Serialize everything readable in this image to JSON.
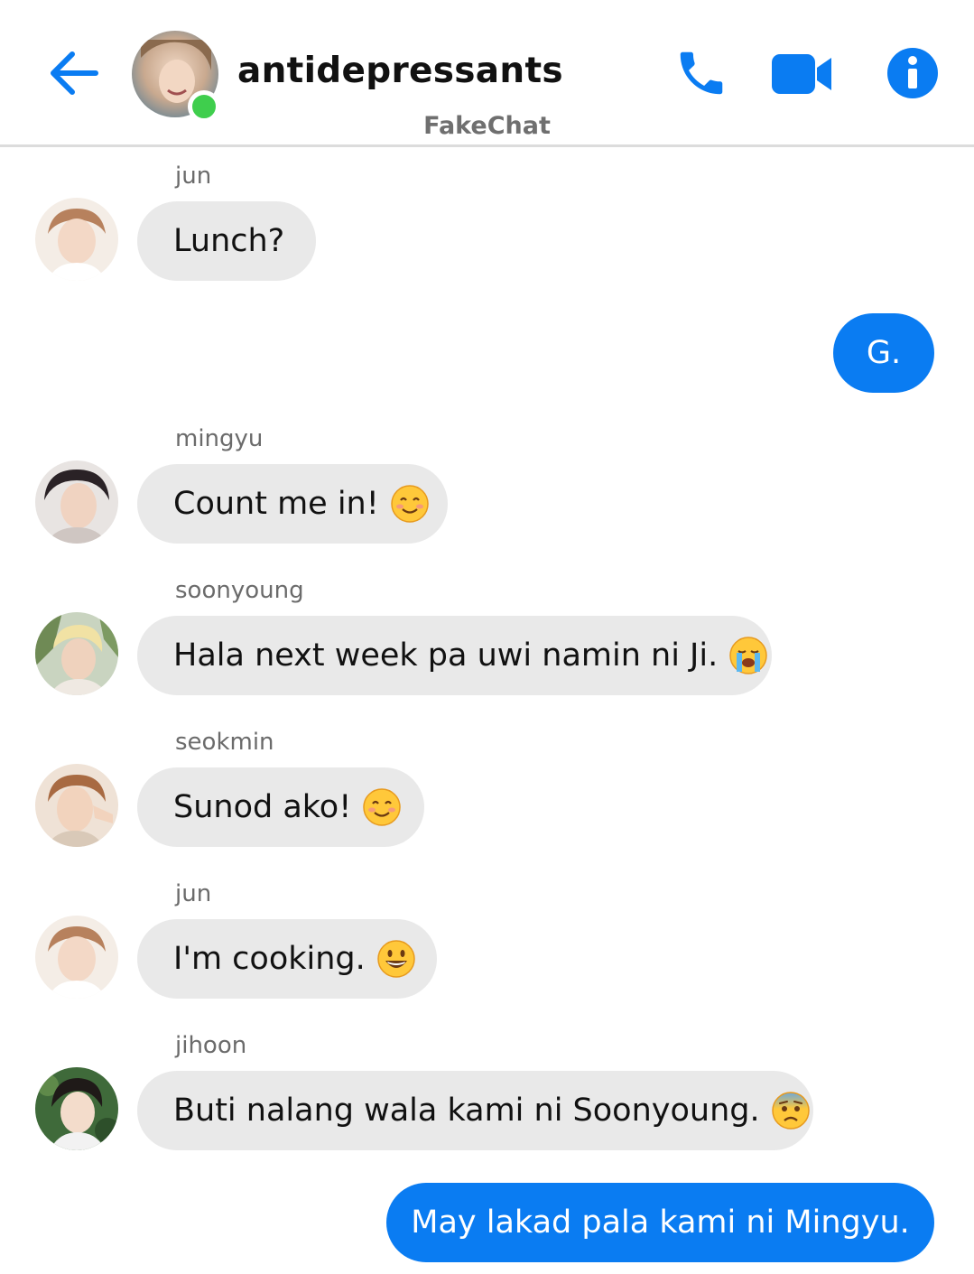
{
  "header": {
    "title": "antidepressants",
    "watermark": "FakeChat",
    "online": true,
    "accent_color": "#0a7cf2"
  },
  "icons": {
    "back": "back-arrow-icon",
    "call": "phone-icon",
    "video": "video-camera-icon",
    "info": "info-icon"
  },
  "colors": {
    "incoming_bubble": "#e9e9e9",
    "outgoing_bubble": "#0a7cf2",
    "online_dot": "#3fce4d"
  },
  "messages": [
    {
      "direction": "in",
      "sender": "jun",
      "text": "Lunch?",
      "emoji": ""
    },
    {
      "direction": "out",
      "sender": "",
      "text": "G.",
      "emoji": ""
    },
    {
      "direction": "in",
      "sender": "mingyu",
      "text": "Count me in!",
      "emoji": "smiling-face"
    },
    {
      "direction": "in",
      "sender": "soonyoung",
      "text": "Hala next week pa uwi namin ni Ji.",
      "emoji": "loudly-crying-face"
    },
    {
      "direction": "in",
      "sender": "seokmin",
      "text": "Sunod ako!",
      "emoji": "smiling-face"
    },
    {
      "direction": "in",
      "sender": "jun",
      "text": "I'm cooking.",
      "emoji": "grinning-face"
    },
    {
      "direction": "in",
      "sender": "jihoon",
      "text": "Buti nalang wala kami ni Soonyoung.",
      "emoji": "anxious-face"
    },
    {
      "direction": "out",
      "sender": "",
      "text": "May lakad pala kami ni Mingyu.",
      "emoji": ""
    }
  ]
}
